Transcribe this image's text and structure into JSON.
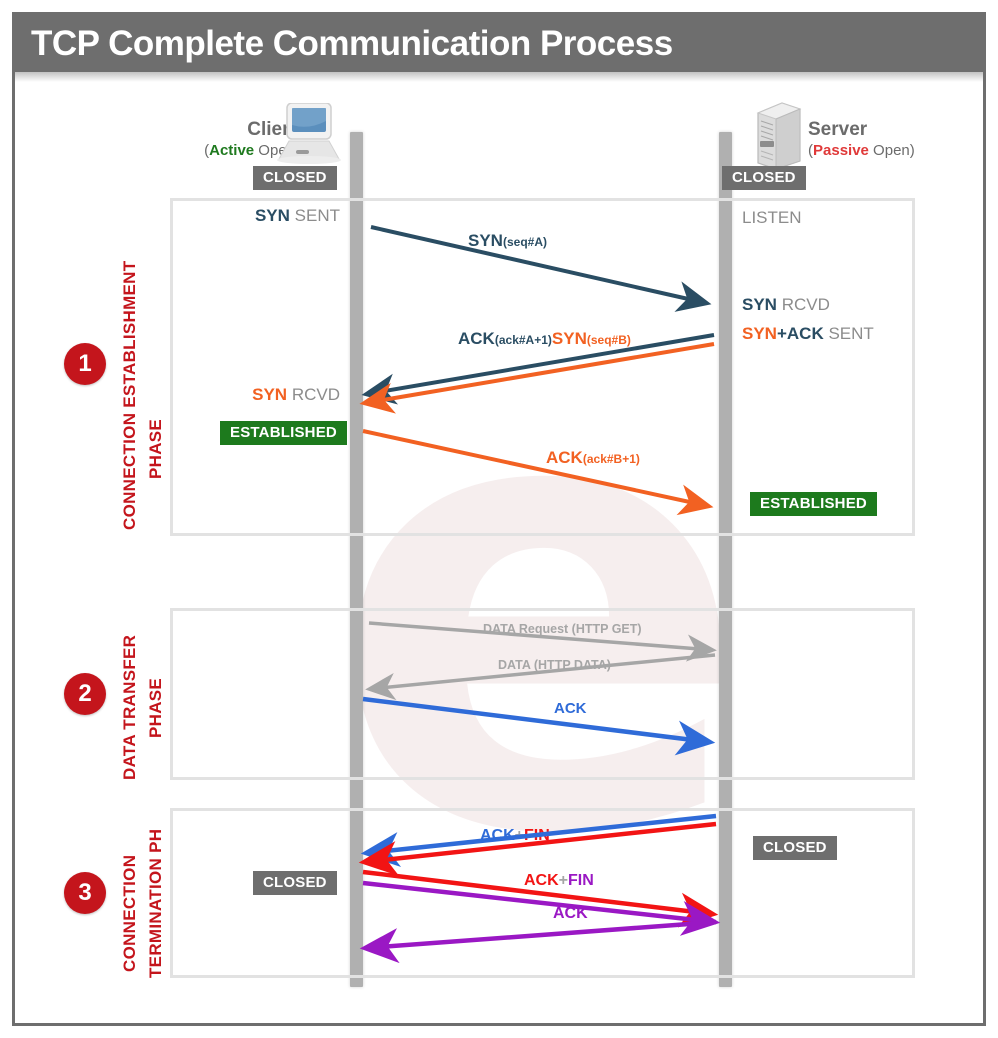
{
  "header": {
    "title": "TCP Complete Communication Process",
    "bar_color": "#6e6e6e"
  },
  "endpoints": {
    "client": {
      "name": "Client",
      "open_type": "Active",
      "open_suffix": " Open)",
      "open_prefix": "(",
      "icon": "desktop-computer-icon",
      "initial_state": "CLOSED"
    },
    "server": {
      "name": "Server",
      "open_type": "Passive",
      "open_suffix": " Open)",
      "open_prefix": "(",
      "icon": "server-tower-icon",
      "initial_state": "CLOSED"
    }
  },
  "phases": [
    {
      "number": "1",
      "label_line1": "CONNECTION ESTABLISHMENT",
      "label_line2": "PHASE",
      "client_states": [
        "SYN SENT",
        "SYN RCVD",
        "ESTABLISHED"
      ],
      "server_states": [
        "LISTEN",
        "SYN RCVD",
        "SYN+ACK SENT",
        "ESTABLISHED"
      ]
    },
    {
      "number": "2",
      "label_line1": "DATA  TRANSFER",
      "label_line2": "PHASE",
      "client_states": [],
      "server_states": []
    },
    {
      "number": "3",
      "label_line1": "CONNECTION",
      "label_line2": "TERMINATION PH",
      "client_states": [
        "CLOSED"
      ],
      "server_states": [
        "CLOSED"
      ]
    }
  ],
  "state_text": {
    "syn_sent_bold": "SYN",
    "syn_sent_rest": " SENT",
    "listen": "LISTEN",
    "syn_rcvd_bold": "SYN",
    "syn_rcvd_rest": " RCVD",
    "synack_bold_1": "SYN",
    "synack_plus": "+",
    "synack_bold_2": "ACK",
    "synack_rest": " SENT"
  },
  "badges": {
    "closed": "CLOSED",
    "established": "ESTABLISHED",
    "closed_color": "#6e6e6e",
    "established_color": "#1d7a1d"
  },
  "messages": [
    {
      "id": "syn",
      "main": "SYN",
      "sub": "(seq#A)",
      "color": "#2a4d63",
      "direction": "client-to-server",
      "phase": 1
    },
    {
      "id": "ack-syn",
      "main1": "ACK",
      "sub1": "(ack#A+1)",
      "main2": "SYN",
      "sub2": "(seq#B)",
      "color1": "#2a4d63",
      "color2": "#f26122",
      "direction": "server-to-client",
      "phase": 1
    },
    {
      "id": "ack-b",
      "main": "ACK",
      "sub": "(ack#B+1)",
      "color": "#f26122",
      "direction": "client-to-server",
      "phase": 1
    },
    {
      "id": "data-request",
      "main": "DATA Request (HTTP GET)",
      "color": "#a6a6a6",
      "direction": "client-to-server",
      "phase": 2
    },
    {
      "id": "data",
      "main": "DATA (HTTP DATA)",
      "color": "#a6a6a6",
      "direction": "server-to-client",
      "phase": 2
    },
    {
      "id": "ack-data",
      "main": "ACK",
      "color": "#2f6bd8",
      "direction": "client-to-server",
      "phase": 2
    },
    {
      "id": "ack-fin-1",
      "part1": "ACK",
      "plus": "+",
      "part2": "FIN",
      "color1": "#2f6bd8",
      "color2": "#f21414",
      "direction": "server-to-client",
      "phase": 3
    },
    {
      "id": "ack-fin-2",
      "part1": "ACK",
      "plus": "+",
      "part2": "FIN",
      "color1": "#f21414",
      "color2": "#9a18c4",
      "direction": "client-to-server",
      "phase": 3
    },
    {
      "id": "ack-final",
      "main": "ACK",
      "color": "#9a18c4",
      "direction": "server-to-client",
      "phase": 3
    }
  ],
  "colors": {
    "frame": "#6e6e6e",
    "phase_red": "#c4151c",
    "lifeline": "#b0b0b0",
    "box_border": "#e2e2e2",
    "dark_blue": "#2a4d63",
    "orange": "#f26122",
    "grey": "#a6a6a6",
    "blue": "#2f6bd8",
    "red": "#f21414",
    "purple": "#9a18c4",
    "green": "#1d7a1d"
  }
}
